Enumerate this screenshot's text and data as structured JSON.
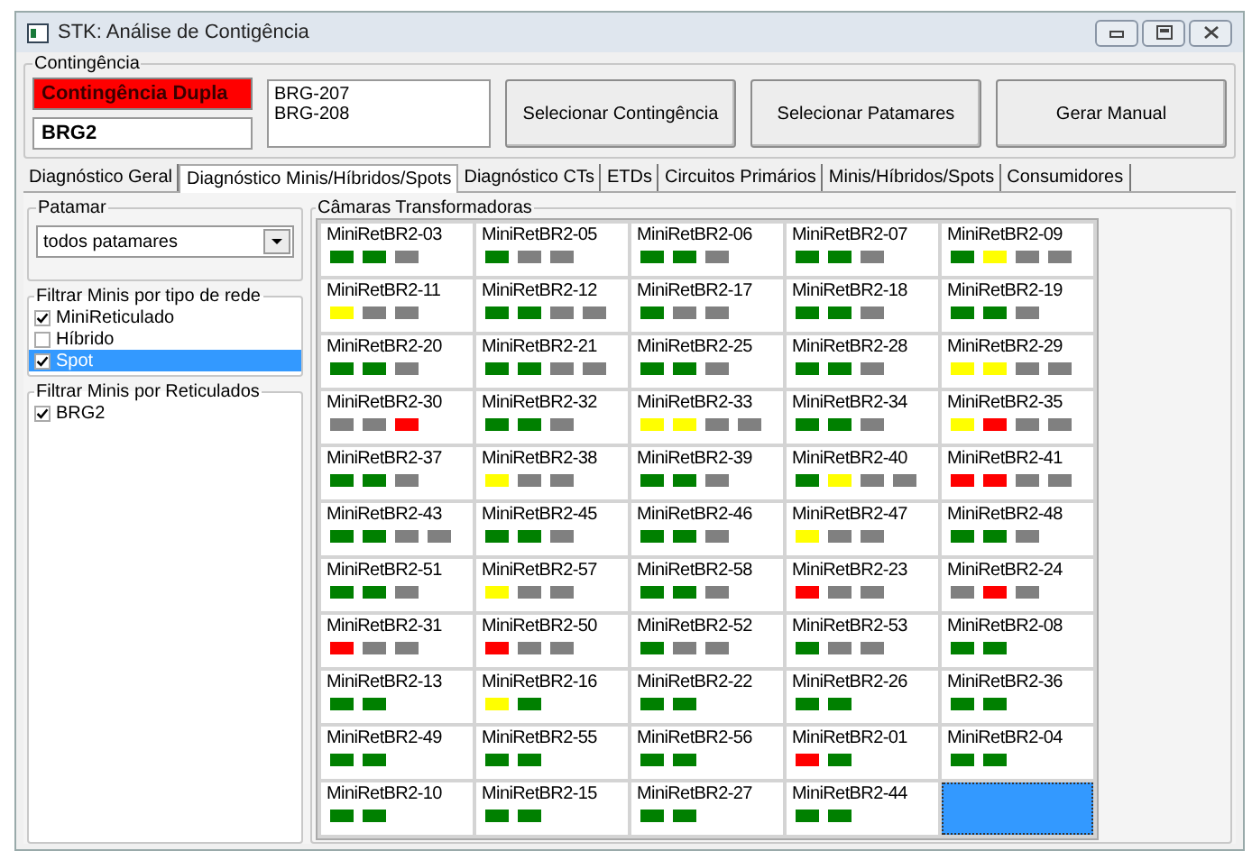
{
  "window": {
    "title": "STK: Análise de Contigência"
  },
  "contingencia": {
    "label": "Contingência",
    "type_field": "Contingência Dupla",
    "circuit_field": "BRG2",
    "list": [
      "BRG-207",
      "BRG-208"
    ],
    "buttons": [
      "Selecionar Contingência",
      "Selecionar Patamares",
      "Gerar Manual"
    ]
  },
  "tabs": [
    {
      "label": "Diagnóstico Geral",
      "selected": false
    },
    {
      "label": "Diagnóstico Minis/Híbridos/Spots",
      "selected": true
    },
    {
      "label": "Diagnóstico CTs",
      "selected": false
    },
    {
      "label": "ETDs",
      "selected": false
    },
    {
      "label": "Circuitos Primários",
      "selected": false
    },
    {
      "label": "Minis/Híbridos/Spots",
      "selected": false
    },
    {
      "label": "Consumidores",
      "selected": false
    }
  ],
  "patamar": {
    "label": "Patamar",
    "value": "todos patamares"
  },
  "filter_type": {
    "label": "Filtrar Minis por tipo de rede",
    "items": [
      {
        "label": "MiniReticulado",
        "checked": true,
        "selected": false
      },
      {
        "label": "Híbrido",
        "checked": false,
        "selected": false
      },
      {
        "label": "Spot",
        "checked": true,
        "selected": true
      }
    ]
  },
  "filter_reticulados": {
    "label": "Filtrar Minis por Reticulados",
    "items": [
      {
        "label": "BRG2",
        "checked": true
      }
    ]
  },
  "cameras": {
    "label": "Câmaras Transformadoras",
    "cards": [
      {
        "name": "MiniRetBR2-03",
        "selected": false,
        "indicators": [
          {
            "color": "#008000"
          },
          {
            "color": "#008000"
          },
          {
            "color": "#808080"
          }
        ]
      },
      {
        "name": "MiniRetBR2-05",
        "selected": false,
        "indicators": [
          {
            "color": "#008000"
          },
          {
            "color": "#808080"
          },
          {
            "color": "#808080"
          }
        ]
      },
      {
        "name": "MiniRetBR2-06",
        "selected": false,
        "indicators": [
          {
            "color": "#008000"
          },
          {
            "color": "#008000"
          },
          {
            "color": "#808080"
          }
        ]
      },
      {
        "name": "MiniRetBR2-07",
        "selected": false,
        "indicators": [
          {
            "color": "#008000"
          },
          {
            "color": "#008000"
          },
          {
            "color": "#808080"
          }
        ]
      },
      {
        "name": "MiniRetBR2-09",
        "selected": false,
        "indicators": [
          {
            "color": "#008000"
          },
          {
            "color": "#ffff00"
          },
          {
            "color": "#808080"
          },
          {
            "color": "#808080"
          }
        ]
      },
      {
        "name": "MiniRetBR2-11",
        "selected": false,
        "indicators": [
          {
            "color": "#ffff00"
          },
          {
            "color": "#808080"
          },
          {
            "color": "#808080"
          }
        ]
      },
      {
        "name": "MiniRetBR2-12",
        "selected": false,
        "indicators": [
          {
            "color": "#008000"
          },
          {
            "color": "#008000"
          },
          {
            "color": "#808080"
          },
          {
            "color": "#808080"
          }
        ]
      },
      {
        "name": "MiniRetBR2-17",
        "selected": false,
        "indicators": [
          {
            "color": "#008000"
          },
          {
            "color": "#808080"
          },
          {
            "color": "#808080"
          }
        ]
      },
      {
        "name": "MiniRetBR2-18",
        "selected": false,
        "indicators": [
          {
            "color": "#008000"
          },
          {
            "color": "#008000"
          },
          {
            "color": "#808080"
          }
        ]
      },
      {
        "name": "MiniRetBR2-19",
        "selected": false,
        "indicators": [
          {
            "color": "#008000"
          },
          {
            "color": "#008000"
          },
          {
            "color": "#808080"
          }
        ]
      },
      {
        "name": "MiniRetBR2-20",
        "selected": false,
        "indicators": [
          {
            "color": "#008000"
          },
          {
            "color": "#008000"
          },
          {
            "color": "#808080"
          }
        ]
      },
      {
        "name": "MiniRetBR2-21",
        "selected": false,
        "indicators": [
          {
            "color": "#008000"
          },
          {
            "color": "#008000"
          },
          {
            "color": "#808080"
          },
          {
            "color": "#808080"
          }
        ]
      },
      {
        "name": "MiniRetBR2-25",
        "selected": false,
        "indicators": [
          {
            "color": "#008000"
          },
          {
            "color": "#008000"
          },
          {
            "color": "#808080"
          }
        ]
      },
      {
        "name": "MiniRetBR2-28",
        "selected": false,
        "indicators": [
          {
            "color": "#008000"
          },
          {
            "color": "#008000"
          },
          {
            "color": "#808080"
          }
        ]
      },
      {
        "name": "MiniRetBR2-29",
        "selected": false,
        "indicators": [
          {
            "color": "#ffff00"
          },
          {
            "color": "#ffff00"
          },
          {
            "color": "#808080"
          },
          {
            "color": "#808080"
          }
        ]
      },
      {
        "name": "MiniRetBR2-30",
        "selected": false,
        "indicators": [
          {
            "color": "#808080"
          },
          {
            "color": "#808080"
          },
          {
            "color": "#ff0000"
          }
        ]
      },
      {
        "name": "MiniRetBR2-32",
        "selected": false,
        "indicators": [
          {
            "color": "#008000"
          },
          {
            "color": "#008000"
          },
          {
            "color": "#808080"
          }
        ]
      },
      {
        "name": "MiniRetBR2-33",
        "selected": false,
        "indicators": [
          {
            "color": "#ffff00"
          },
          {
            "color": "#ffff00"
          },
          {
            "color": "#808080"
          },
          {
            "color": "#808080"
          }
        ]
      },
      {
        "name": "MiniRetBR2-34",
        "selected": false,
        "indicators": [
          {
            "color": "#008000"
          },
          {
            "color": "#008000"
          },
          {
            "color": "#808080"
          }
        ]
      },
      {
        "name": "MiniRetBR2-35",
        "selected": false,
        "indicators": [
          {
            "color": "#ffff00"
          },
          {
            "color": "#ff0000"
          },
          {
            "color": "#808080"
          },
          {
            "color": "#808080"
          }
        ]
      },
      {
        "name": "MiniRetBR2-37",
        "selected": false,
        "indicators": [
          {
            "color": "#008000"
          },
          {
            "color": "#008000"
          },
          {
            "color": "#808080"
          }
        ]
      },
      {
        "name": "MiniRetBR2-38",
        "selected": false,
        "indicators": [
          {
            "color": "#ffff00"
          },
          {
            "color": "#808080"
          },
          {
            "color": "#808080"
          }
        ]
      },
      {
        "name": "MiniRetBR2-39",
        "selected": false,
        "indicators": [
          {
            "color": "#008000"
          },
          {
            "color": "#008000"
          },
          {
            "color": "#808080"
          }
        ]
      },
      {
        "name": "MiniRetBR2-40",
        "selected": false,
        "indicators": [
          {
            "color": "#008000"
          },
          {
            "color": "#ffff00"
          },
          {
            "color": "#808080"
          },
          {
            "color": "#808080"
          }
        ]
      },
      {
        "name": "MiniRetBR2-41",
        "selected": false,
        "indicators": [
          {
            "color": "#ff0000"
          },
          {
            "color": "#ff0000"
          },
          {
            "color": "#808080"
          },
          {
            "color": "#808080"
          }
        ]
      },
      {
        "name": "MiniRetBR2-43",
        "selected": false,
        "indicators": [
          {
            "color": "#008000"
          },
          {
            "color": "#008000"
          },
          {
            "color": "#808080"
          },
          {
            "color": "#808080"
          }
        ]
      },
      {
        "name": "MiniRetBR2-45",
        "selected": false,
        "indicators": [
          {
            "color": "#008000"
          },
          {
            "color": "#008000"
          },
          {
            "color": "#808080"
          }
        ]
      },
      {
        "name": "MiniRetBR2-46",
        "selected": false,
        "indicators": [
          {
            "color": "#008000"
          },
          {
            "color": "#008000"
          },
          {
            "color": "#808080"
          }
        ]
      },
      {
        "name": "MiniRetBR2-47",
        "selected": false,
        "indicators": [
          {
            "color": "#ffff00"
          },
          {
            "color": "#808080"
          },
          {
            "color": "#808080"
          }
        ]
      },
      {
        "name": "MiniRetBR2-48",
        "selected": false,
        "indicators": [
          {
            "color": "#008000"
          },
          {
            "color": "#008000"
          },
          {
            "color": "#808080"
          }
        ]
      },
      {
        "name": "MiniRetBR2-51",
        "selected": false,
        "indicators": [
          {
            "color": "#008000"
          },
          {
            "color": "#008000"
          },
          {
            "color": "#808080"
          }
        ]
      },
      {
        "name": "MiniRetBR2-57",
        "selected": false,
        "indicators": [
          {
            "color": "#ffff00"
          },
          {
            "color": "#808080"
          },
          {
            "color": "#808080"
          }
        ]
      },
      {
        "name": "MiniRetBR2-58",
        "selected": false,
        "indicators": [
          {
            "color": "#008000"
          },
          {
            "color": "#008000"
          },
          {
            "color": "#808080"
          }
        ]
      },
      {
        "name": "MiniRetBR2-23",
        "selected": false,
        "indicators": [
          {
            "color": "#ff0000"
          },
          {
            "color": "#808080"
          },
          {
            "color": "#808080"
          }
        ]
      },
      {
        "name": "MiniRetBR2-24",
        "selected": false,
        "indicators": [
          {
            "color": "#808080"
          },
          {
            "color": "#ff0000"
          },
          {
            "color": "#808080"
          }
        ]
      },
      {
        "name": "MiniRetBR2-31",
        "selected": false,
        "indicators": [
          {
            "color": "#ff0000"
          },
          {
            "color": "#808080"
          },
          {
            "color": "#808080"
          }
        ]
      },
      {
        "name": "MiniRetBR2-50",
        "selected": false,
        "indicators": [
          {
            "color": "#ff0000"
          },
          {
            "color": "#808080"
          },
          {
            "color": "#808080"
          }
        ]
      },
      {
        "name": "MiniRetBR2-52",
        "selected": false,
        "indicators": [
          {
            "color": "#008000"
          },
          {
            "color": "#808080"
          },
          {
            "color": "#808080"
          }
        ]
      },
      {
        "name": "MiniRetBR2-53",
        "selected": false,
        "indicators": [
          {
            "color": "#008000"
          },
          {
            "color": "#808080"
          },
          {
            "color": "#808080"
          }
        ]
      },
      {
        "name": "MiniRetBR2-08",
        "selected": false,
        "indicators": [
          {
            "color": "#008000"
          },
          {
            "color": "#008000"
          }
        ]
      },
      {
        "name": "MiniRetBR2-13",
        "selected": false,
        "indicators": [
          {
            "color": "#008000"
          },
          {
            "color": "#008000"
          }
        ]
      },
      {
        "name": "MiniRetBR2-16",
        "selected": false,
        "indicators": [
          {
            "color": "#ffff00"
          },
          {
            "color": "#008000"
          }
        ]
      },
      {
        "name": "MiniRetBR2-22",
        "selected": false,
        "indicators": [
          {
            "color": "#008000"
          },
          {
            "color": "#008000"
          }
        ]
      },
      {
        "name": "MiniRetBR2-26",
        "selected": false,
        "indicators": [
          {
            "color": "#008000"
          },
          {
            "color": "#008000"
          }
        ]
      },
      {
        "name": "MiniRetBR2-36",
        "selected": false,
        "indicators": [
          {
            "color": "#008000"
          },
          {
            "color": "#008000"
          }
        ]
      },
      {
        "name": "MiniRetBR2-49",
        "selected": false,
        "indicators": [
          {
            "color": "#008000"
          },
          {
            "color": "#008000"
          }
        ]
      },
      {
        "name": "MiniRetBR2-55",
        "selected": false,
        "indicators": [
          {
            "color": "#008000"
          },
          {
            "color": "#008000"
          }
        ]
      },
      {
        "name": "MiniRetBR2-56",
        "selected": false,
        "indicators": [
          {
            "color": "#008000"
          },
          {
            "color": "#008000"
          }
        ]
      },
      {
        "name": "MiniRetBR2-01",
        "selected": false,
        "indicators": [
          {
            "color": "#ff0000"
          },
          {
            "color": "#008000"
          }
        ]
      },
      {
        "name": "MiniRetBR2-04",
        "selected": false,
        "indicators": [
          {
            "color": "#008000"
          },
          {
            "color": "#008000"
          }
        ]
      },
      {
        "name": "MiniRetBR2-10",
        "selected": false,
        "indicators": [
          {
            "color": "#008000"
          },
          {
            "color": "#008000"
          }
        ]
      },
      {
        "name": "MiniRetBR2-15",
        "selected": false,
        "indicators": [
          {
            "color": "#008000"
          },
          {
            "color": "#008000"
          }
        ]
      },
      {
        "name": "MiniRetBR2-27",
        "selected": false,
        "indicators": [
          {
            "color": "#008000"
          },
          {
            "color": "#008000"
          }
        ]
      },
      {
        "name": "MiniRetBR2-44",
        "selected": false,
        "indicators": [
          {
            "color": "#008000"
          },
          {
            "color": "#008000"
          }
        ]
      },
      {
        "selected": true
      }
    ]
  }
}
